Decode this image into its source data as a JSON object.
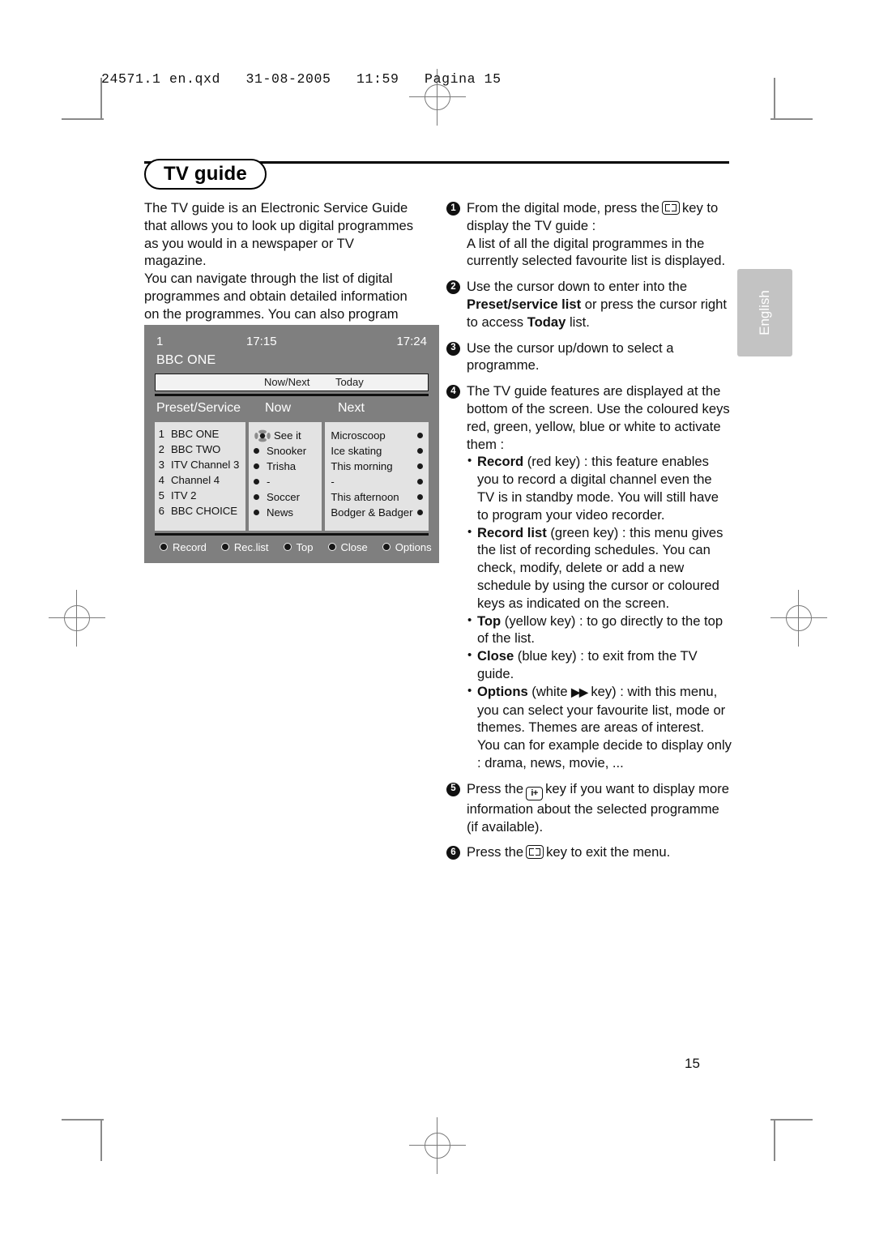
{
  "print_header": "24571.1 en.qxd   31-08-2005   11:59   Pagina 15",
  "page_number": "15",
  "language_tab": "English",
  "section": {
    "title": "TV guide"
  },
  "intro": {
    "paragraph_1": "The TV guide is an Electronic Service Guide that allows you to look up digital programmes as you would in a newspaper or TV magazine.",
    "paragraph_2": "You can navigate through the list of digital programmes and obtain detailed information on the programmes. You can also program the TV to provide a digital channel to be recorded."
  },
  "tv_guide_screen": {
    "preset_number": "1",
    "time_start": "17:15",
    "time_end": "17:24",
    "channel_name": "BBC ONE",
    "tabs": [
      "Now/Next",
      "Today"
    ],
    "column_headers": [
      "Preset/Service",
      "Now",
      "Next"
    ],
    "rows": [
      {
        "num": "1",
        "service": "BBC ONE",
        "now": "See it",
        "next": "Microscoop"
      },
      {
        "num": "2",
        "service": "BBC TWO",
        "now": "Snooker",
        "next": "Ice skating"
      },
      {
        "num": "3",
        "service": "ITV Channel 3",
        "now": "Trisha",
        "next": "This morning"
      },
      {
        "num": "4",
        "service": "Channel 4",
        "now": "-",
        "next": "-"
      },
      {
        "num": "5",
        "service": "ITV 2",
        "now": "Soccer",
        "next": "This afternoon"
      },
      {
        "num": "6",
        "service": "BBC CHOICE",
        "now": "News",
        "next": "Bodger & Badger"
      }
    ],
    "colour_keys": [
      {
        "label": "Record",
        "colour": "#d41f1f"
      },
      {
        "label": "Rec.list",
        "colour": "#1f9a34"
      },
      {
        "label": "Top",
        "colour": "#d8c31b"
      },
      {
        "label": "Close",
        "colour": "#2143b8"
      },
      {
        "label": "Options",
        "colour": "#ffffff"
      }
    ]
  },
  "steps": {
    "s1": {
      "num": "1",
      "line_a_pre": "From the digital mode, press the",
      "line_a_post": "key to display the TV guide :",
      "line_b": "A list of all the digital programmes in the currently selected favourite list is displayed."
    },
    "s2": {
      "num": "2",
      "pre": "Use the cursor down to enter into the ",
      "bold_1": "Preset/service list",
      "mid": " or press the cursor right to access ",
      "bold_2": "Today",
      "post": " list."
    },
    "s3": {
      "num": "3",
      "text": "Use the cursor up/down to select a programme."
    },
    "s4": {
      "num": "4",
      "lead": "The TV guide features are displayed at the bottom of the screen. Use the coloured keys red, green, yellow, blue or white to activate them :",
      "bullets": [
        {
          "bold": "Record",
          "text": " (red key) : this feature enables you to record a digital channel even the TV is in standby mode. You will still have to program your video recorder."
        },
        {
          "bold": "Record list",
          "text": " (green key) : this menu gives the list of recording schedules. You can check, modify, delete or add a new schedule by using the cursor or coloured keys as indicated on the screen."
        },
        {
          "bold": "Top",
          "text": " (yellow key) : to go directly to the top of the list."
        },
        {
          "bold": "Close",
          "text": " (blue key) : to exit from the TV guide."
        }
      ],
      "options_bullet": {
        "bold": "Options",
        "pre": " (white ",
        "glyph": "▶▶",
        "post": " key) : with this menu, you can select your favourite list, mode or themes. Themes are areas of interest.",
        "extra": "You can for example decide to display only : drama, news, movie, ..."
      }
    },
    "s5": {
      "num": "5",
      "pre": "Press the",
      "key_label": "i+",
      "post": "key if you want to display more information about the selected programme (if available)."
    },
    "s6": {
      "num": "6",
      "pre": "Press the",
      "post": "key to exit the menu."
    }
  }
}
